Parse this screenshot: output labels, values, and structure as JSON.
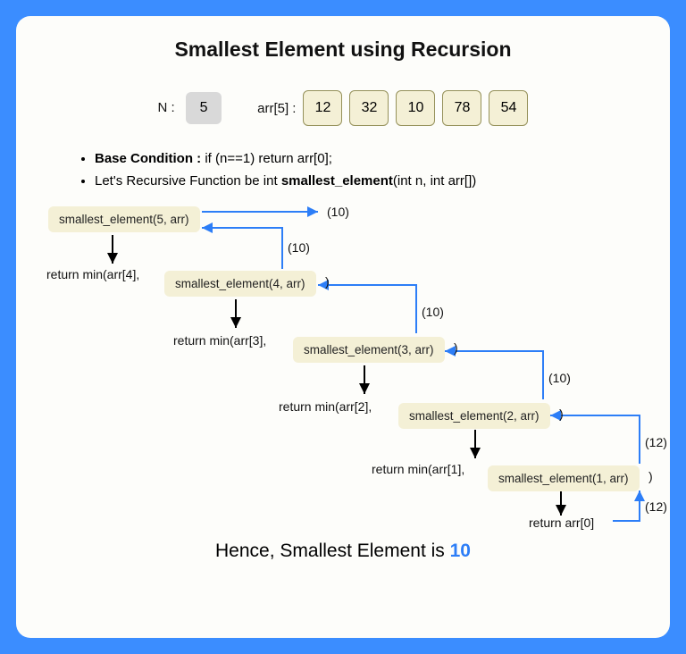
{
  "title": "Smallest Element using Recursion",
  "n_label": "N :",
  "n_value": "5",
  "arr_label": "arr[5] :",
  "arr": [
    "12",
    "32",
    "10",
    "78",
    "54"
  ],
  "bullet1_strong": "Base Condition : ",
  "bullet1_rest": "if (n==1) return arr[0];",
  "bullet2_pre": "Let's Recursive Function be int ",
  "bullet2_strong": "smallest_element",
  "bullet2_post": "(int n, int arr[])",
  "calls": {
    "c5": "smallest_element(5, arr)",
    "c4": "smallest_element(4, arr)",
    "c3": "smallest_element(3, arr)",
    "c2": "smallest_element(2, arr)",
    "c1": "smallest_element(1, arr)"
  },
  "rets": {
    "r4": "return min(arr[4],",
    "r3": "return min(arr[3],",
    "r2": "return min(arr[2],",
    "r1": "return min(arr[1],",
    "r0": "return arr[0]"
  },
  "paren": ")",
  "vals": {
    "v5": "(10)",
    "v4": "(10)",
    "v3": "(10)",
    "v2": "(10)",
    "v1": "(12)",
    "v0": "(12)"
  },
  "conclusion_pre": "Hence, Smallest Element is ",
  "answer": "10"
}
